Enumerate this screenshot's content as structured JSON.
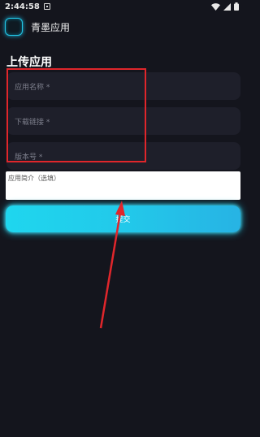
{
  "status_bar": {
    "time": "2:44:58",
    "icons": [
      "notification-icon",
      "wifi-icon",
      "signal-icon",
      "battery-icon"
    ]
  },
  "app_bar": {
    "title": "青墨应用",
    "icon": "app-logo-icon"
  },
  "form": {
    "section_title": "上传应用",
    "app_name_placeholder": "应用名称 *",
    "download_link_placeholder": "下载链接 *",
    "version_placeholder": "版本号 *",
    "description_placeholder": "应用简介（选填）",
    "submit_label": "提交"
  },
  "colors": {
    "background": "#14151d",
    "field": "#1e1f2a",
    "accent": "#22c9ea",
    "highlight": "#e0262b"
  }
}
